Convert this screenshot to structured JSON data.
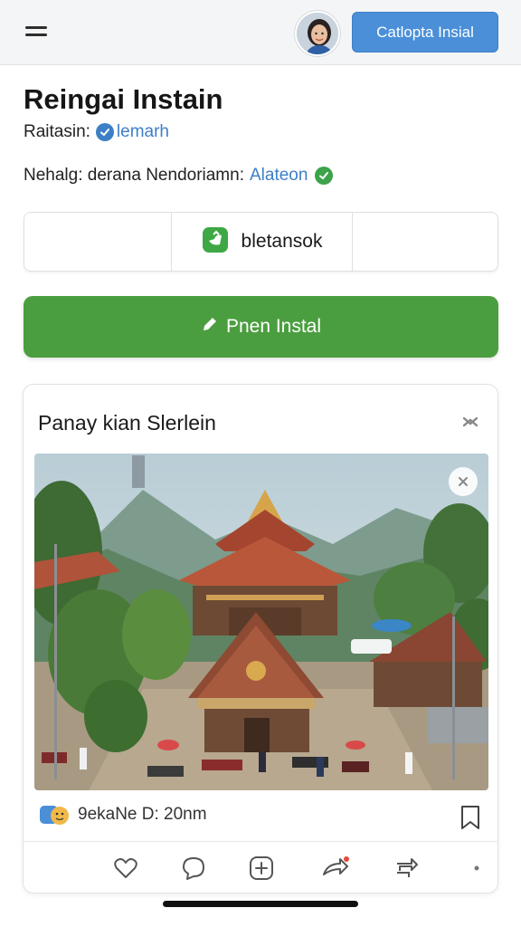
{
  "header": {
    "cta_label": "Catlopta Insial",
    "menu_icon": "hamburger-menu-icon",
    "avatar_icon": "user-avatar"
  },
  "page": {
    "title": "Reingai Instain",
    "meta1_prefix": "Raitasin:",
    "meta1_link": "lemarh",
    "meta2_prefix": "Nehalg: derana Nendoriamn:",
    "meta2_link": "Alateon"
  },
  "segments": {
    "items": [
      {
        "label": ""
      },
      {
        "label": "bletansok",
        "icon": "green-app-icon"
      },
      {
        "label": ""
      }
    ]
  },
  "primary_button": {
    "label": "Pnen Instal",
    "icon": "pencil-icon"
  },
  "card": {
    "title": "Panay kian Slerlein",
    "source_label": "9ekaNe D: 20nm",
    "photo_description_icon": "temple-photo",
    "actions": [
      "heart-icon",
      "comment-icon",
      "add-icon",
      "share-icon",
      "repost-icon",
      "more-icon"
    ]
  },
  "colors": {
    "accent_blue": "#4a8fd8",
    "primary_green": "#4b9e3f",
    "link_blue": "#3d7fc6"
  }
}
